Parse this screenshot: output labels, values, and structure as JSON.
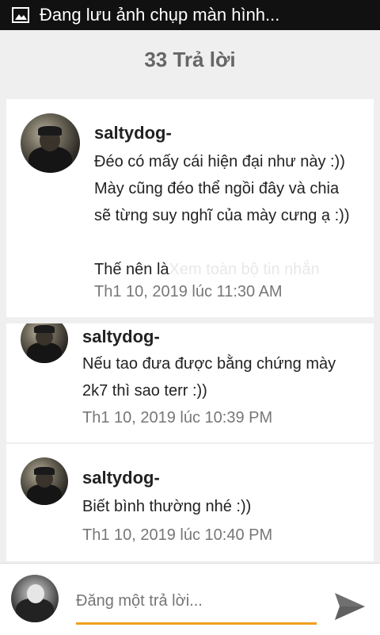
{
  "status_bar": {
    "text": "Đang lưu ảnh chụp màn hình...",
    "icon": "image-icon"
  },
  "header": {
    "title": "33 Trả lời"
  },
  "main_post": {
    "author": "saltydog-",
    "message": "Đéo có mấy cái hiện đại như này :))\nMày cũng đéo thể ngồi đây và chia\nsẽ từng suy nghĩ của mày cưng ạ :))\n\nThế nên là",
    "see_more": "Xem toàn bộ tin nhắn",
    "timestamp": "Th1 10, 2019 lúc 11:30 AM"
  },
  "replies": [
    {
      "author": "saltydog-",
      "message": "Nếu tao đưa được bằng chứng mày\n2k7 thì sao terr :))",
      "timestamp": "Th1 10, 2019 lúc 10:39 PM"
    },
    {
      "author": "saltydog-",
      "message": "Biết bình thường nhé :))",
      "timestamp": "Th1 10, 2019 lúc 10:40 PM"
    }
  ],
  "composer": {
    "placeholder": "Đăng một trả lời...",
    "send_icon": "send-icon",
    "accent": "#f0a020"
  }
}
